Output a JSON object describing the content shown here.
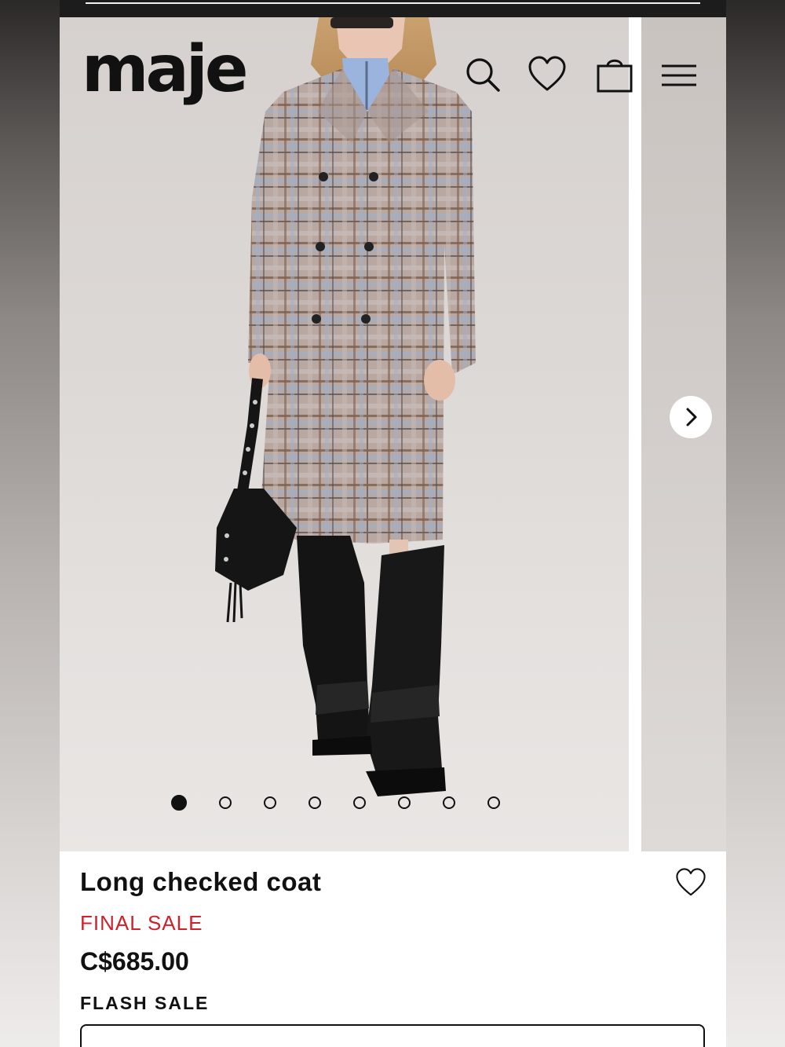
{
  "brand": {
    "logo_text": "maje"
  },
  "header": {
    "icons": [
      "search-icon",
      "heart-icon",
      "shopping-bag-icon",
      "menu-icon"
    ]
  },
  "carousel": {
    "image_count": 8,
    "active_index": 0,
    "next_icon": "chevron-right-icon"
  },
  "product": {
    "name": "Long checked coat",
    "sale_label": "FINAL SALE",
    "price": "C$685.00",
    "promo_label": "FLASH SALE",
    "favorite_icon": "heart-outline-icon"
  },
  "colors": {
    "sale_red": "#d0202a",
    "text": "#111111",
    "background": "#ffffff"
  }
}
